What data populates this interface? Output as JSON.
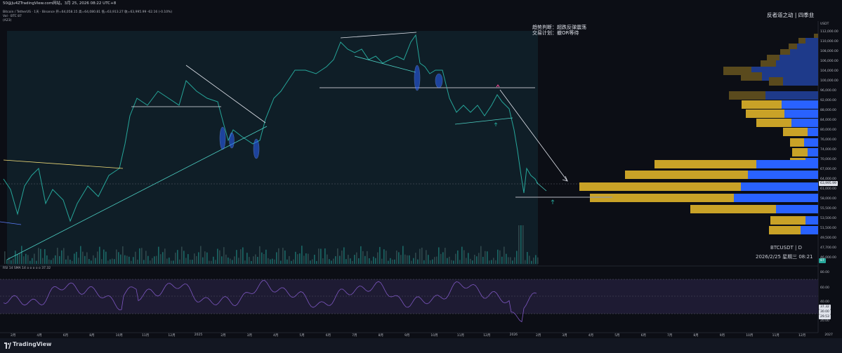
{
  "header": {
    "top_line": "50@Ju4ZTradingView.com网站，3月 25, 2026 08:22 UTC+8",
    "symbol_line": "Bitcoin / TetherUS · 1天 · Binance  开=64,058.15  高=64,080.81  低=63,913.27  收=63,995.99  -62.16 (-0.10%)",
    "vol_line": "Vol · BTC  87",
    "ind_line": "(A23)"
  },
  "price_axis": {
    "unit": "USDT",
    "labels": [
      "112,000.00",
      "110,000.00",
      "108,000.00",
      "106,000.00",
      "104,000.00",
      "100,000.00",
      "96,000.00",
      "92,000.00",
      "88,000.00",
      "84,000.00",
      "80,000.00",
      "76,000.00",
      "74,000.00",
      "70,000.00",
      "67,000.00",
      "64,000.00",
      "61,000.00",
      "58,000.00",
      "55,500.00",
      "53,500.00",
      "51,500.00",
      "49,500.00",
      "47,700.00",
      "46,000.00"
    ],
    "current_price": "63,995.99",
    "vol_tag": "87"
  },
  "rsi": {
    "label": "RSI 14 SMA 14",
    "value_line": "o o o o o  37.32",
    "levels": [
      "80.00",
      "60.00",
      "40.00",
      "20.00"
    ],
    "value_tag": "37.32",
    "tag2": "30.00",
    "tag3": "29.53"
  },
  "time_axis": [
    "2月",
    "4月",
    "6月",
    "8月",
    "10月",
    "11月",
    "12月",
    "2025",
    "2月",
    "3月",
    "4月",
    "5月",
    "6月",
    "7月",
    "8月",
    "9月",
    "10月",
    "11月",
    "12月",
    "2026",
    "2月",
    "3月",
    "4月",
    "5月",
    "6月",
    "7月",
    "8月",
    "9月",
    "10月",
    "11月",
    "12月",
    "2027"
  ],
  "annotations": {
    "trend_label": "趋势判断：",
    "trend_value": "超跌反弹震荡",
    "plan_label": "交易计划：",
    "plan_value": "撤OR等待",
    "watermark": "反者道之动 | 四季韭",
    "symbol_tf": "BTCUSDT  |  D",
    "datetime": "2026/2/25 星期三 08:21"
  },
  "brand": {
    "name": "TradingView"
  },
  "colors": {
    "background": "#0c0e15",
    "candle": "#26a69a",
    "volume_profile_up": "#2962ff",
    "volume_profile_down": "#c9a227",
    "rsi_line": "#7e57c2",
    "trendline_white": "#e0e3eb",
    "trendline_yellow": "#f5e07a",
    "trendline_teal": "#4dd0c4"
  }
}
